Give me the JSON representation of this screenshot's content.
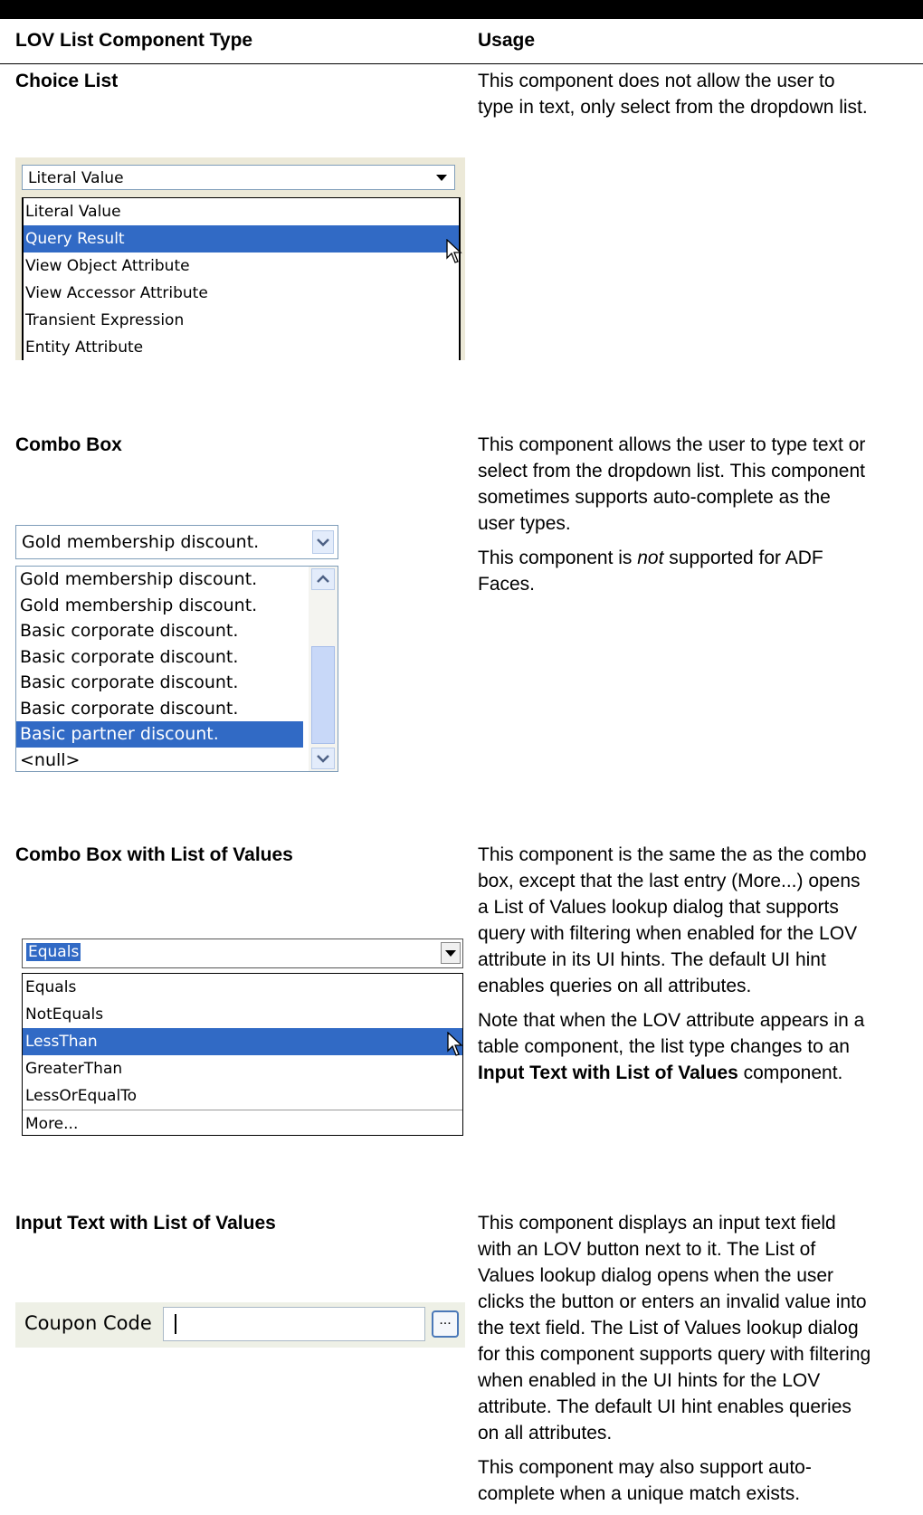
{
  "table": {
    "header": {
      "col1": "LOV List Component Type",
      "col2": "Usage"
    },
    "rows": [
      {
        "type": "Choice List",
        "usage": [
          "This component does not allow the user to",
          "type in text, only select from the dropdown list."
        ],
        "widget": {
          "selected_value": "Literal Value",
          "options": [
            "Literal Value",
            "Query Result",
            "View Object Attribute",
            "View Accessor Attribute",
            "Transient Expression",
            "Entity Attribute"
          ],
          "highlighted": "Query Result"
        }
      },
      {
        "type": "Combo Box",
        "usage": [
          "This component allows the user to type text or",
          "select from the dropdown list. This component",
          "sometimes supports auto-complete as the",
          "user types."
        ],
        "usage2_pre": "This component is ",
        "usage2_em": "not",
        "usage2_post": " supported for ADF",
        "usage2_line2": "Faces.",
        "widget": {
          "value": "Gold membership discount.",
          "options": [
            "Gold membership discount.",
            "Gold membership discount.",
            "Basic corporate discount.",
            "Basic corporate discount.",
            "Basic corporate discount.",
            "Basic corporate discount.",
            "Basic partner discount.",
            "<null>"
          ],
          "highlighted": "Basic partner discount."
        }
      },
      {
        "type": "Combo Box with List of Values",
        "usage": [
          "This component is the same the as the combo",
          "box, except that the last entry (More...) opens",
          "a List of Values lookup dialog that supports",
          "query with filtering when enabled for the LOV",
          "attribute in its UI hints. The default UI hint",
          "enables queries on all attributes."
        ],
        "usage2": [
          "Note that when the LOV attribute appears in a",
          "table component, the list type changes to an"
        ],
        "usage2_bold": "Input Text with List of Values",
        "usage2_tail": " component.",
        "widget": {
          "value": "Equals",
          "options": [
            "Equals",
            "NotEquals",
            "LessThan",
            "GreaterThan",
            "LessOrEqualTo"
          ],
          "more": "More...",
          "highlighted": "LessThan"
        }
      },
      {
        "type": "Input Text with List of Values",
        "usage": [
          "This component displays an input text field",
          "with an LOV button next to it. The List of",
          "Values lookup dialog opens when the user",
          "clicks the button or enters an invalid value into",
          "the text field. The List of Values lookup dialog",
          "for this component supports query with filtering",
          "when enabled in the UI hints for the LOV",
          "attribute. The default UI hint enables queries",
          "on all attributes."
        ],
        "usage2": [
          "This component may also support auto-",
          "complete when a unique match exists."
        ],
        "widget": {
          "label": "Coupon Code",
          "value": "",
          "button": "..."
        }
      }
    ]
  }
}
